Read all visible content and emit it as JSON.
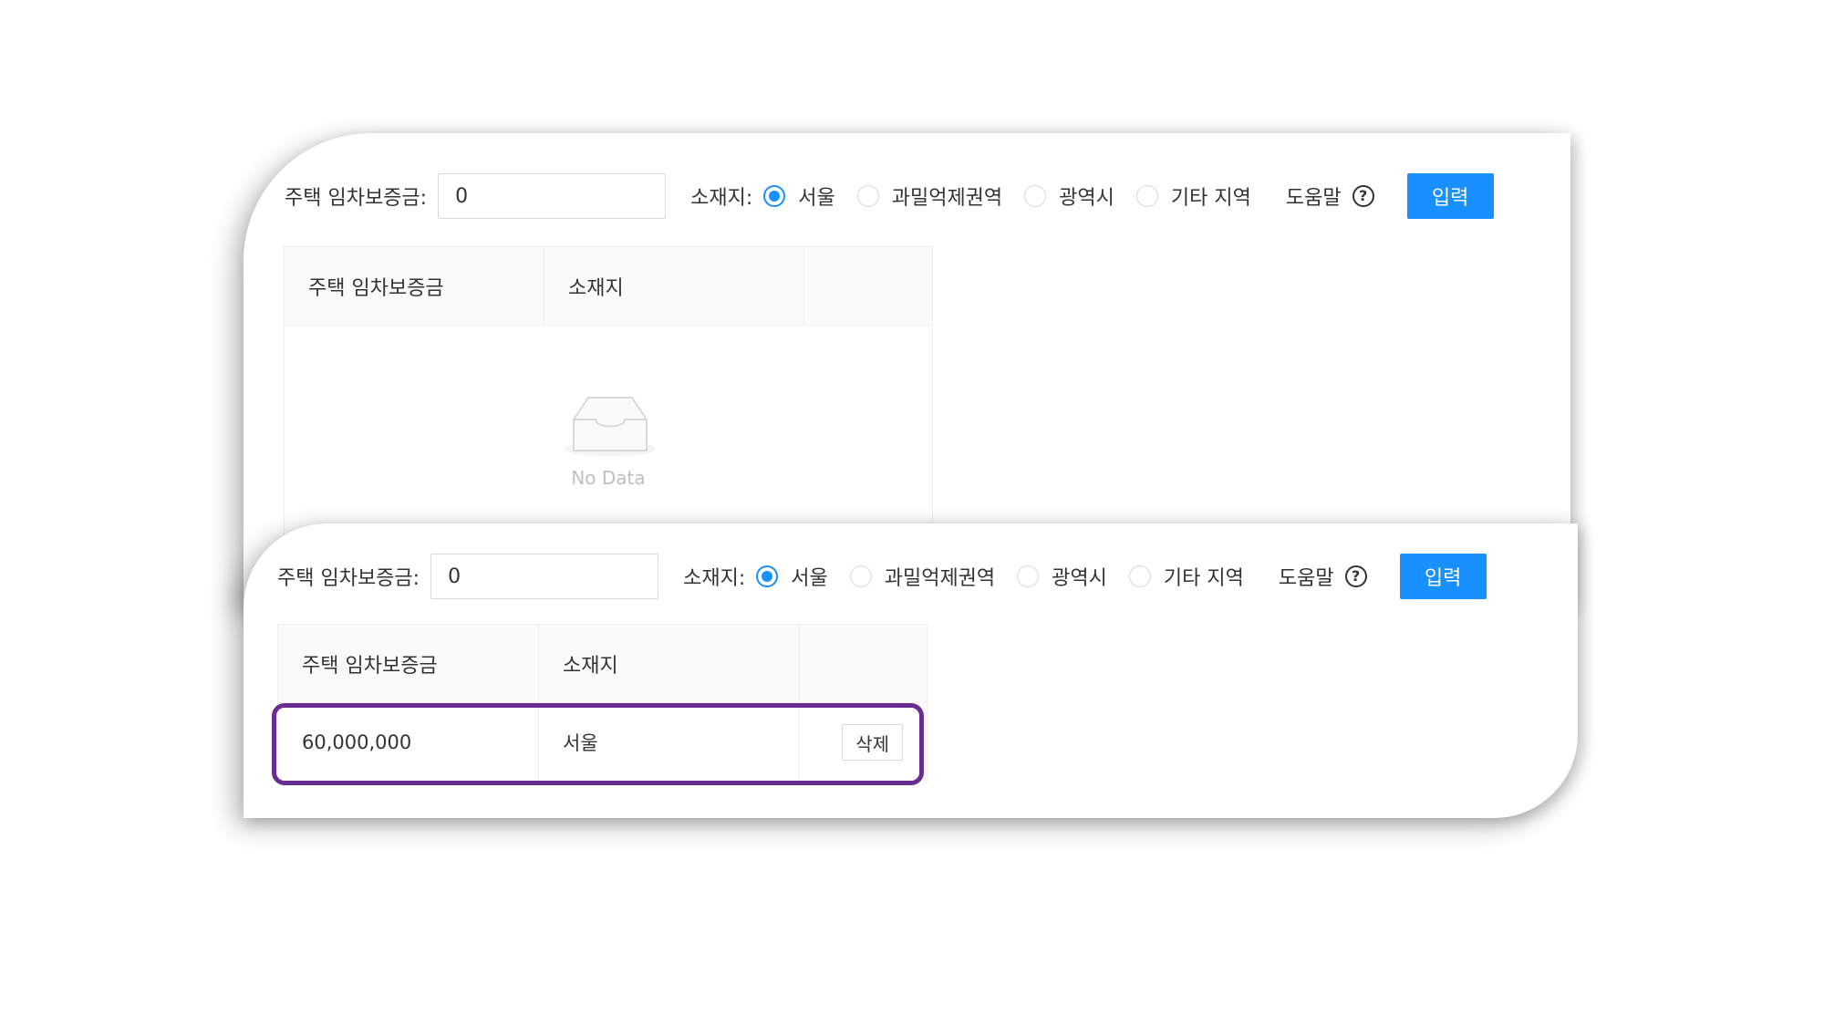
{
  "form": {
    "deposit_label": "주택 임차보증금:",
    "deposit_value": "0",
    "location_label": "소재지:",
    "options": [
      "서울",
      "과밀억제권역",
      "광역시",
      "기타 지역"
    ],
    "selected_option": "서울",
    "help_label": "도움말",
    "help_icon_glyph": "?",
    "submit_label": "입력",
    "accent_color": "#1890ff"
  },
  "table": {
    "columns": [
      "주택 임차보증금",
      "소재지",
      ""
    ],
    "empty_text": "No Data"
  },
  "result_row": {
    "deposit": "60,000,000",
    "location": "서울",
    "delete_label": "삭제"
  },
  "highlight_color": "#6a2c91"
}
